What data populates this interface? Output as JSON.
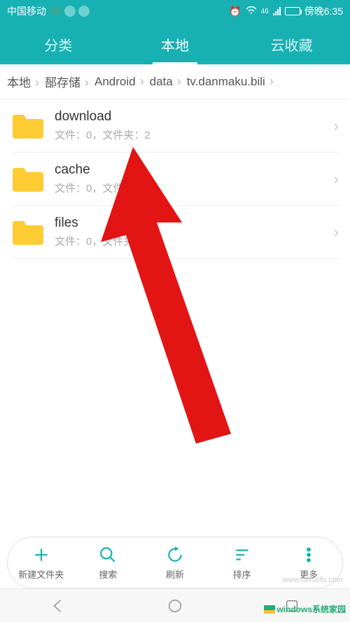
{
  "status": {
    "carrier": "中国移动",
    "alarm_icon": "⏰",
    "wifi_label": "46",
    "time": "傍晚6:35"
  },
  "tabs": [
    {
      "label": "分类",
      "active": false
    },
    {
      "label": "本地",
      "active": true
    },
    {
      "label": "云收藏",
      "active": false
    }
  ],
  "breadcrumb": [
    "本地",
    "郚存储",
    "Android",
    "data",
    "tv.danmaku.bili"
  ],
  "folders": [
    {
      "name": "download",
      "sub": "文件：0，文件夹：2"
    },
    {
      "name": "cache",
      "sub": "文件：0，文件夹：4"
    },
    {
      "name": "files",
      "sub": "文件：0，文件夹：6"
    }
  ],
  "actions": {
    "new_folder": "新建文件夹",
    "search": "搜索",
    "refresh": "刷新",
    "sort": "排序",
    "more": "更多"
  },
  "watermark_site": "windows系统家园",
  "watermark_url": "www.ruihaifu.com"
}
